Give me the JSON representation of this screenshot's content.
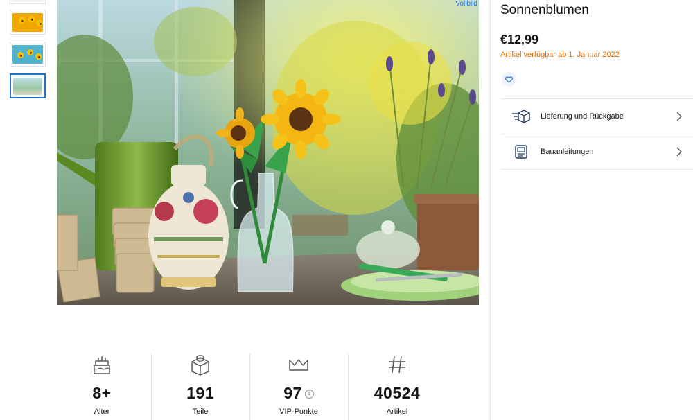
{
  "gallery": {
    "thumbnails": [
      {
        "name": "thumbnail-1"
      },
      {
        "name": "thumbnail-2"
      },
      {
        "name": "thumbnail-3"
      },
      {
        "name": "thumbnail-4",
        "active": true
      }
    ],
    "fullimage_label": "Vollbild"
  },
  "facts": [
    {
      "icon": "cake-icon",
      "value": "8+",
      "label": "Alter"
    },
    {
      "icon": "brick-icon",
      "value": "191",
      "label": "Teile"
    },
    {
      "icon": "crown-icon",
      "value": "97",
      "label": "VIP-Punkte",
      "info_icon": "info-icon"
    },
    {
      "icon": "hash-icon",
      "value": "40524",
      "label": "Artikel"
    }
  ],
  "product": {
    "title": "Sonnenblumen",
    "price": "€12,99",
    "availability": "Artikel verfügbar ab 1. Januar 2022",
    "wishlist_icon": "heart-icon"
  },
  "info_rows": [
    {
      "icon": "delivery-box-icon",
      "label": "Lieferung und Rückgabe"
    },
    {
      "icon": "instructions-icon",
      "label": "Bauanleitungen"
    }
  ],
  "colors": {
    "accent_blue": "#1f6fd1",
    "availability_orange": "#e06c00"
  }
}
